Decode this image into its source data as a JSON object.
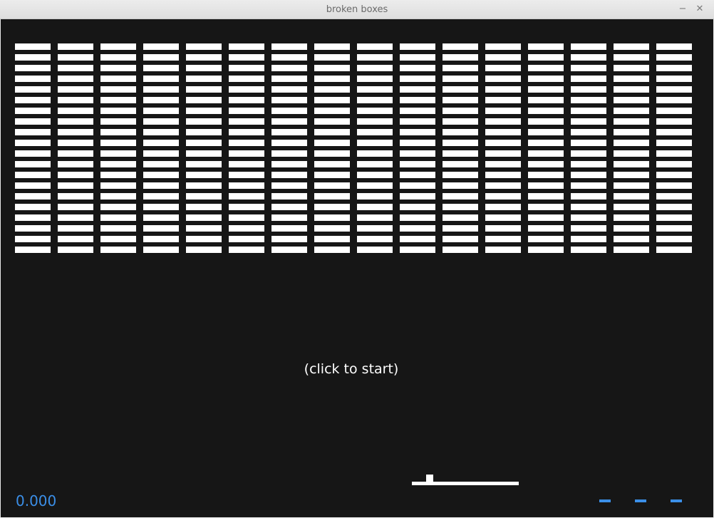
{
  "window": {
    "title": "broken boxes",
    "minimize_glyph": "−",
    "close_glyph": "✕"
  },
  "game": {
    "hint": "(click to start)",
    "score": "0.000",
    "lives": 3,
    "bricks": {
      "columns": 16,
      "rows": 20,
      "remaining": 320,
      "color": "#ffffff"
    },
    "colors": {
      "background": "#161616",
      "hud": "#3b8fe8",
      "paddle": "#ffffff",
      "ball": "#ffffff"
    }
  }
}
